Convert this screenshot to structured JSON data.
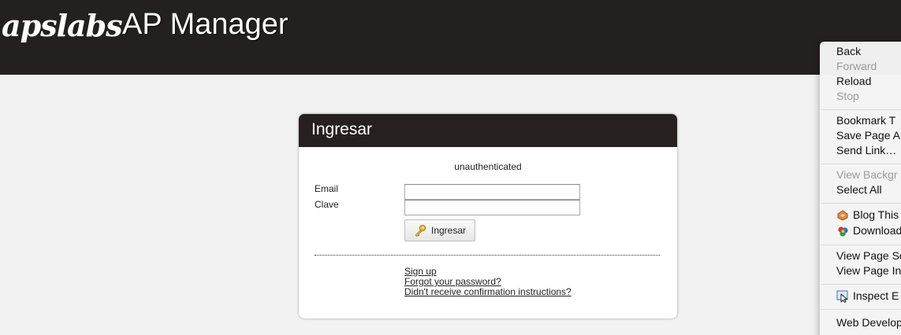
{
  "header": {
    "logo": "apslabs",
    "title": "AP Manager"
  },
  "login": {
    "panel_title": "Ingresar",
    "notice": "unauthenticated",
    "email_label": "Email",
    "password_label": "Clave",
    "email_value": "",
    "password_value": "",
    "submit_label": "Ingresar",
    "links": {
      "sign_up": "Sign up",
      "forgot_password": "Forgot your password?",
      "resend_confirmation": "Didn't receive confirmation instructions?"
    }
  },
  "context_menu": {
    "back": "Back",
    "forward": "Forward",
    "reload": "Reload",
    "stop": "Stop",
    "bookmark": "Bookmark T",
    "save_page": "Save Page A",
    "send_link": "Send Link…",
    "view_background": "View Backgr",
    "select_all": "Select All",
    "blog_this": "Blog This",
    "download": "Download",
    "view_page_source": "View Page So",
    "view_page_info": "View Page In",
    "inspect_element": "Inspect E",
    "web_developer": "Web Develop"
  },
  "colors": {
    "header_bg": "#252020",
    "panel_header_bg": "#262020",
    "page_bg": "#f2f2f2"
  }
}
